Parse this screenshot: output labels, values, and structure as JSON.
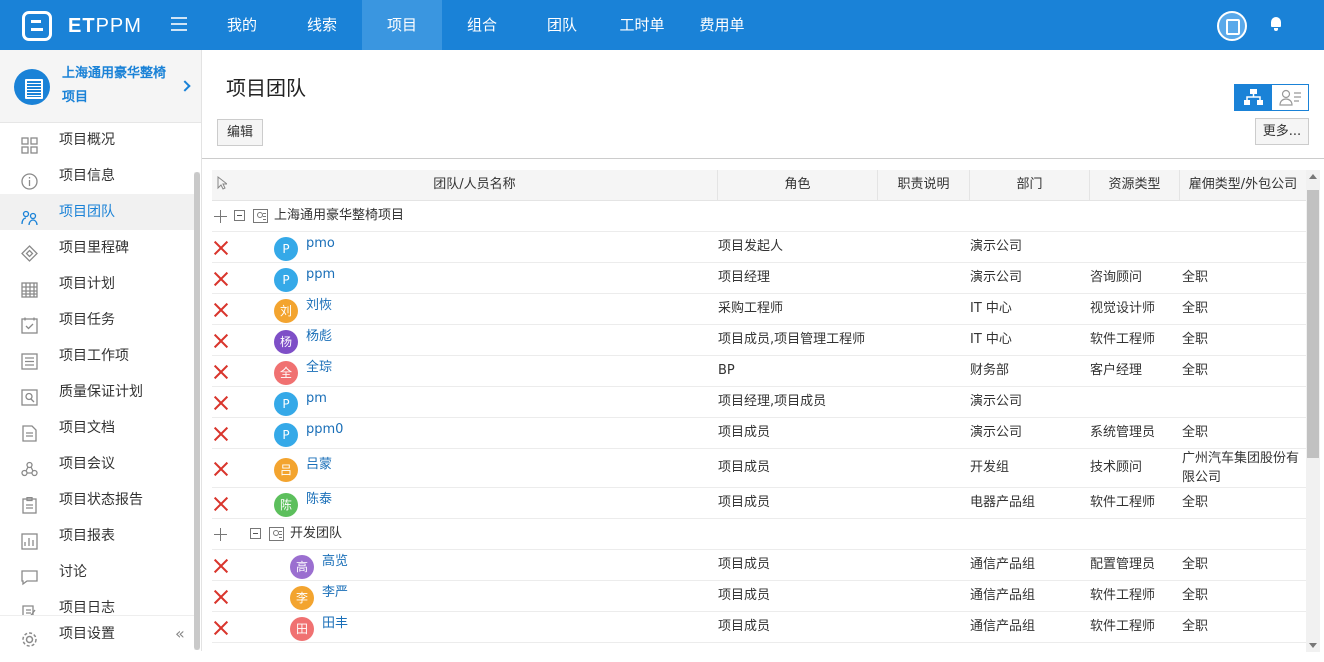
{
  "app": {
    "brand_bold": "ET",
    "brand_light": "PPM"
  },
  "nav": {
    "items": [
      "我的",
      "线索",
      "项目",
      "组合",
      "团队",
      "工时单",
      "费用单"
    ],
    "active": "项目"
  },
  "project": {
    "name": "上海通用豪华整椅项目"
  },
  "sidebar": {
    "items": [
      {
        "label": "项目概况",
        "icon": "grid-icon"
      },
      {
        "label": "项目信息",
        "icon": "info-icon"
      },
      {
        "label": "项目团队",
        "icon": "team-icon",
        "active": true
      },
      {
        "label": "项目里程碑",
        "icon": "milestone-icon"
      },
      {
        "label": "项目计划",
        "icon": "calendar-icon"
      },
      {
        "label": "项目任务",
        "icon": "task-icon"
      },
      {
        "label": "项目工作项",
        "icon": "list-icon"
      },
      {
        "label": "质量保证计划",
        "icon": "quality-icon"
      },
      {
        "label": "项目文档",
        "icon": "document-icon"
      },
      {
        "label": "项目会议",
        "icon": "meeting-icon"
      },
      {
        "label": "项目状态报告",
        "icon": "report-icon"
      },
      {
        "label": "项目报表",
        "icon": "chart-icon"
      },
      {
        "label": "讨论",
        "icon": "chat-icon"
      },
      {
        "label": "项目日志",
        "icon": "log-icon"
      }
    ],
    "footer": {
      "label": "项目设置",
      "icon": "settings-icon"
    }
  },
  "page": {
    "title": "项目团队",
    "edit_label": "编辑",
    "more_label": "更多..."
  },
  "table": {
    "headers": [
      "团队/人员名称",
      "角色",
      "职责说明",
      "部门",
      "资源类型",
      "雇佣类型/外包公司"
    ],
    "groups": [
      {
        "name": "上海通用豪华整椅项目",
        "members": [
          {
            "initial": "P",
            "name": "pmo",
            "role": "项目发起人",
            "duty": "",
            "dept": "演示公司",
            "resource": "",
            "employment": "",
            "color": "#35a9e8"
          },
          {
            "initial": "P",
            "name": "ppm",
            "role": "项目经理",
            "duty": "",
            "dept": "演示公司",
            "resource": "咨询顾问",
            "employment": "全职",
            "color": "#35a9e8"
          },
          {
            "initial": "刘",
            "name": "刘恢",
            "role": "采购工程师",
            "duty": "",
            "dept": "IT 中心",
            "resource": "视觉设计师",
            "employment": "全职",
            "color": "#f3a42f"
          },
          {
            "initial": "杨",
            "name": "杨彪",
            "role": "项目成员,项目管理工程师",
            "duty": "",
            "dept": "IT 中心",
            "resource": "软件工程师",
            "employment": "全职",
            "color": "#7e4fc7"
          },
          {
            "initial": "全",
            "name": "全琮",
            "role": "BP",
            "duty": "",
            "dept": "财务部",
            "resource": "客户经理",
            "employment": "全职",
            "color": "#f07171"
          },
          {
            "initial": "P",
            "name": "pm",
            "role": "项目经理,项目成员",
            "duty": "",
            "dept": "演示公司",
            "resource": "",
            "employment": "",
            "color": "#35a9e8"
          },
          {
            "initial": "P",
            "name": "ppm0",
            "role": "项目成员",
            "duty": "",
            "dept": "演示公司",
            "resource": "系统管理员",
            "employment": "全职",
            "color": "#35a9e8"
          },
          {
            "initial": "吕",
            "name": "吕蒙",
            "role": "项目成员",
            "duty": "",
            "dept": "开发组",
            "resource": "技术顾问",
            "employment": "广州汽车集团股份有限公司",
            "color": "#f3a42f"
          },
          {
            "initial": "陈",
            "name": "陈泰",
            "role": "项目成员",
            "duty": "",
            "dept": "电器产品组",
            "resource": "软件工程师",
            "employment": "全职",
            "color": "#5cbf5c"
          }
        ]
      },
      {
        "name": "开发团队",
        "members": [
          {
            "initial": "高",
            "name": "高览",
            "role": "项目成员",
            "duty": "",
            "dept": "通信产品组",
            "resource": "配置管理员",
            "employment": "全职",
            "color": "#9b6fd0"
          },
          {
            "initial": "李",
            "name": "李严",
            "role": "项目成员",
            "duty": "",
            "dept": "通信产品组",
            "resource": "软件工程师",
            "employment": "全职",
            "color": "#f3a42f"
          },
          {
            "initial": "田",
            "name": "田丰",
            "role": "项目成员",
            "duty": "",
            "dept": "通信产品组",
            "resource": "软件工程师",
            "employment": "全职",
            "color": "#f07171"
          }
        ]
      }
    ]
  },
  "colors": {
    "brand": "#1a82d7",
    "delete": "#d9352c",
    "link": "#1a6fb8"
  }
}
